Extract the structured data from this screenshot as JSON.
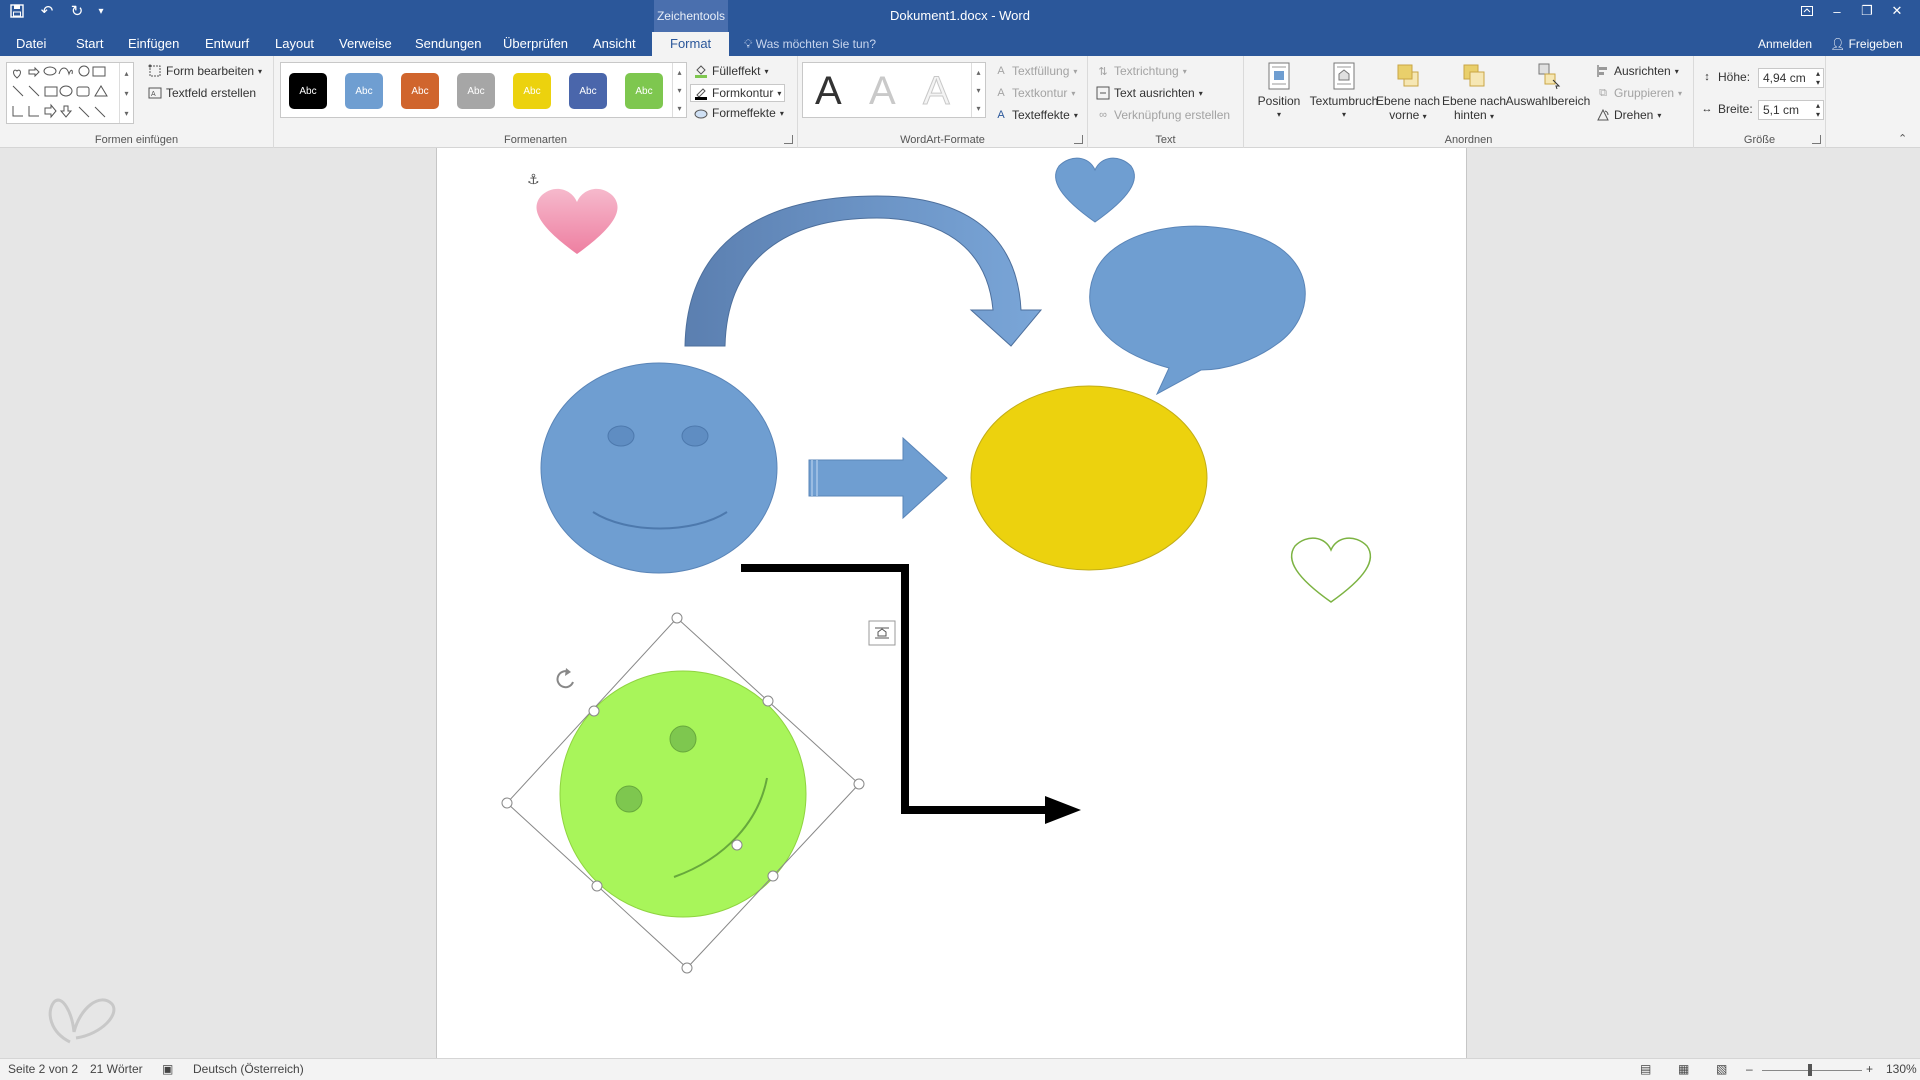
{
  "titlebar": {
    "doc_title": "Dokument1.docx - Word",
    "context_tab": "Zeichentools",
    "quick_access": {
      "save": "save-icon",
      "undo": "undo-icon",
      "redo": "redo-icon",
      "customize": "customize-icon"
    },
    "window_buttons": {
      "ribbon_display": "ribbon-display-icon",
      "minimize": "minimize-icon",
      "restore": "restore-icon",
      "close": "close-icon"
    }
  },
  "tabs": [
    {
      "label": "Datei"
    },
    {
      "label": "Start"
    },
    {
      "label": "Einfügen"
    },
    {
      "label": "Entwurf"
    },
    {
      "label": "Layout"
    },
    {
      "label": "Verweise"
    },
    {
      "label": "Sendungen"
    },
    {
      "label": "Überprüfen"
    },
    {
      "label": "Ansicht"
    },
    {
      "label": "Format"
    }
  ],
  "tell_me": "Was möchten Sie tun?",
  "account": {
    "signin": "Anmelden",
    "share": "Freigeben"
  },
  "ribbon": {
    "insert_shapes": {
      "label": "Formen einfügen",
      "edit_shape": "Form bearbeiten",
      "text_box": "Textfeld erstellen"
    },
    "shape_styles": {
      "label": "Formenarten",
      "swatch_text": "Abc",
      "swatches": [
        "#000000",
        "#6f9ed1",
        "#d0652d",
        "#a6a6a6",
        "#ecd20e",
        "#4a66ab",
        "#7ec74f"
      ],
      "fill": "Fülleffekt",
      "outline": "Formkontur",
      "effects": "Formeffekte"
    },
    "wordart": {
      "label": "WordArt-Formate",
      "letter": "A",
      "text_fill": "Textfüllung",
      "text_outline": "Textkontur",
      "text_effects": "Texteffekte"
    },
    "text": {
      "label": "Text",
      "direction": "Textrichtung",
      "align": "Text ausrichten",
      "link": "Verknüpfung erstellen"
    },
    "arrange": {
      "label": "Anordnen",
      "position": "Position",
      "wrap": "Textumbruch",
      "forward_1": "Ebene nach",
      "forward_2": "vorne",
      "backward_1": "Ebene nach",
      "backward_2": "hinten",
      "selection_pane": "Auswahlbereich",
      "align": "Ausrichten",
      "group": "Gruppieren",
      "rotate": "Drehen"
    },
    "size": {
      "label": "Größe",
      "height_label": "Höhe:",
      "height_value": "4,94 cm",
      "width_label": "Breite:",
      "width_value": "5,1 cm"
    }
  },
  "statusbar": {
    "page": "Seite 2 von 2",
    "words": "21 Wörter",
    "language": "Deutsch (Österreich)",
    "zoom": "130%",
    "zoom_level_percent": 130
  },
  "colors": {
    "title_blue": "#2b579a",
    "shape_blue": "#6f9ed1",
    "shape_yellow": "#ecd20e",
    "shape_green": "#a8f55a",
    "heart_pink": "#f08aa8"
  }
}
